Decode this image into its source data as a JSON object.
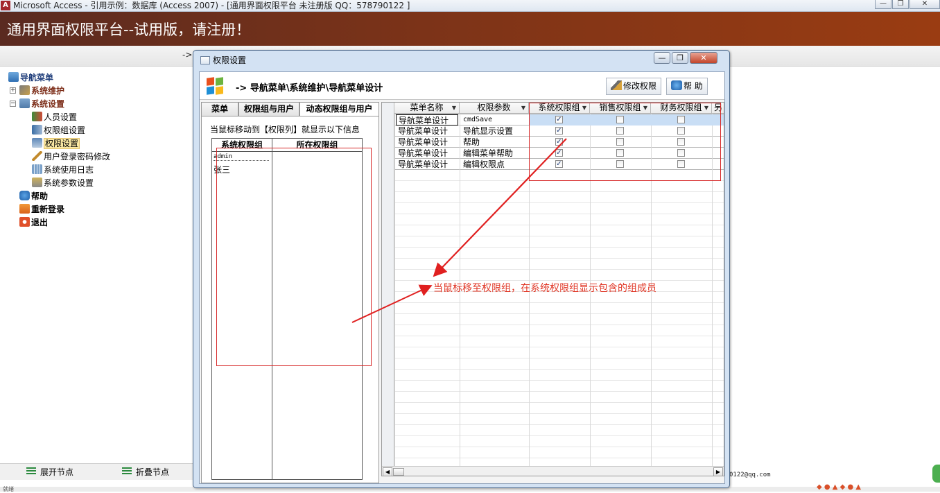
{
  "window": {
    "title": "Microsoft Access - 引用示例：数据库 (Access 2007) - [通用界面权限平台  未注册版 QQ：578790122  ]",
    "app_icon_letter": "A",
    "controls": {
      "minimize": "—",
      "restore": "❐",
      "close": "✕"
    }
  },
  "banner": {
    "title": "通用界面权限平台--试用版，请注册！"
  },
  "band": {
    "arrow": "->"
  },
  "nav_tree": {
    "root": "导航菜单",
    "nodes": [
      {
        "label": "系统维护",
        "icon": "tools-icon"
      },
      {
        "label": "系统设置",
        "icon": "settings-folder-icon"
      },
      {
        "label": "人员设置",
        "icon": "users-icon"
      },
      {
        "label": "权限组设置",
        "icon": "group-icon"
      },
      {
        "label": "权限设置",
        "icon": "permission-icon"
      },
      {
        "label": "用户登录密码修改",
        "icon": "pencil-icon"
      },
      {
        "label": "系统使用日志",
        "icon": "log-icon"
      },
      {
        "label": "系统参数设置",
        "icon": "params-icon"
      },
      {
        "label": "帮助",
        "icon": "help-icon"
      },
      {
        "label": "重新登录",
        "icon": "relogin-icon"
      },
      {
        "label": "退出",
        "icon": "exit-icon"
      }
    ],
    "expand_plus": "+",
    "expand_minus": "−"
  },
  "bottom_bar": {
    "expand_label": "展开节点",
    "collapse_label": "折叠节点"
  },
  "dialog": {
    "title": "权限设置",
    "controls": {
      "minimize": "—",
      "restore": "❐",
      "close": "✕"
    },
    "breadcrumb": "-> 导航菜单\\系统维护\\导航菜单设计",
    "toolbar": {
      "modify_label": "修改权限",
      "help_label": "帮 助"
    },
    "tabs": [
      "菜单",
      "权限组与用户",
      "动态权限组与用户"
    ],
    "info_note": "当鼠标移动到【权限列】就显示以下信息",
    "member_table": {
      "headers": [
        "系统权限组",
        "所在权限组"
      ],
      "rows": [
        "admin",
        "张三"
      ]
    },
    "grid": {
      "columns": [
        "菜单名称",
        "权限参数",
        "系统权限组",
        "销售权限组",
        "财务权限组",
        "另"
      ],
      "rows": [
        {
          "menu": "导航菜单设计",
          "param": "cmdSave",
          "sys": true,
          "sales": false,
          "finance": false
        },
        {
          "menu": "导航菜单设计",
          "param": "导航显示设置",
          "sys": true,
          "sales": false,
          "finance": false
        },
        {
          "menu": "导航菜单设计",
          "param": "帮助",
          "sys": true,
          "sales": false,
          "finance": false
        },
        {
          "menu": "导航菜单设计",
          "param": "编辑菜单帮助",
          "sys": true,
          "sales": false,
          "finance": false
        },
        {
          "menu": "导航菜单设计",
          "param": "编辑权限点",
          "sys": true,
          "sales": false,
          "finance": false
        }
      ],
      "check_mark": "✓",
      "scroll_left": "◀",
      "scroll_right": "▶"
    }
  },
  "annotation": "当鼠标移至权限组，在系统权限组显示包含的组成员",
  "status_email": "0122@qq.com",
  "status_left": "就绪",
  "colors": {
    "banner": "#7c3318",
    "annotation_red": "#e03524",
    "row_selected": "#c9def5"
  }
}
